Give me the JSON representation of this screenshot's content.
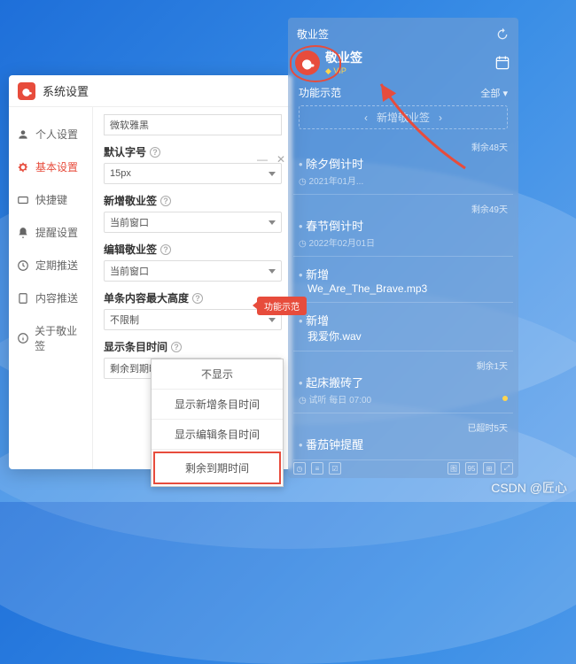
{
  "settings": {
    "title": "系统设置",
    "sidebar": [
      {
        "key": "personal",
        "label": "个人设置"
      },
      {
        "key": "basic",
        "label": "基本设置"
      },
      {
        "key": "shortcut",
        "label": "快捷键"
      },
      {
        "key": "reminder",
        "label": "提醒设置"
      },
      {
        "key": "push",
        "label": "定期推送"
      },
      {
        "key": "content",
        "label": "内容推送"
      },
      {
        "key": "about",
        "label": "关于敬业签"
      }
    ],
    "fields": {
      "font_value": "微软雅黑",
      "default_fontsize_label": "默认字号",
      "default_fontsize_value": "15px",
      "new_window_label": "新增敬业签",
      "new_window_value": "当前窗口",
      "edit_window_label": "编辑敬业签",
      "edit_window_value": "当前窗口",
      "max_height_label": "单条内容最大高度",
      "max_height_value": "不限制",
      "display_time_label": "显示条目时间",
      "display_time_value": "剩余到期时间"
    },
    "tooltip": "功能示范",
    "dropdown": [
      "不显示",
      "显示新增条目时间",
      "显示编辑条目时间",
      "剩余到期时间"
    ]
  },
  "notes": {
    "header_title": "敬业签",
    "brand": "敬业签",
    "vip": "VIP",
    "func_label": "功能示范",
    "all_label": "全部 ▾",
    "add_label": "新增敬业签",
    "items": [
      {
        "remain": "剩余48天",
        "title": "除夕倒计时",
        "date": "2021年01月..."
      },
      {
        "remain": "剩余49天",
        "title": "春节倒计时",
        "date": "2022年02月01日"
      },
      {
        "remain": "",
        "title": "新增",
        "subtitle": "We_Are_The_Brave.mp3",
        "date": ""
      },
      {
        "remain": "",
        "title": "新增",
        "subtitle": "我爱你.wav",
        "date": ""
      },
      {
        "remain": "剩余1天",
        "title": "起床搬砖了",
        "date": "每日 07:00"
      },
      {
        "remain": "已超时5天",
        "title": "番茄钟提醒",
        "date": ""
      }
    ],
    "try_label": "试听"
  },
  "watermark": "CSDN @匠心"
}
